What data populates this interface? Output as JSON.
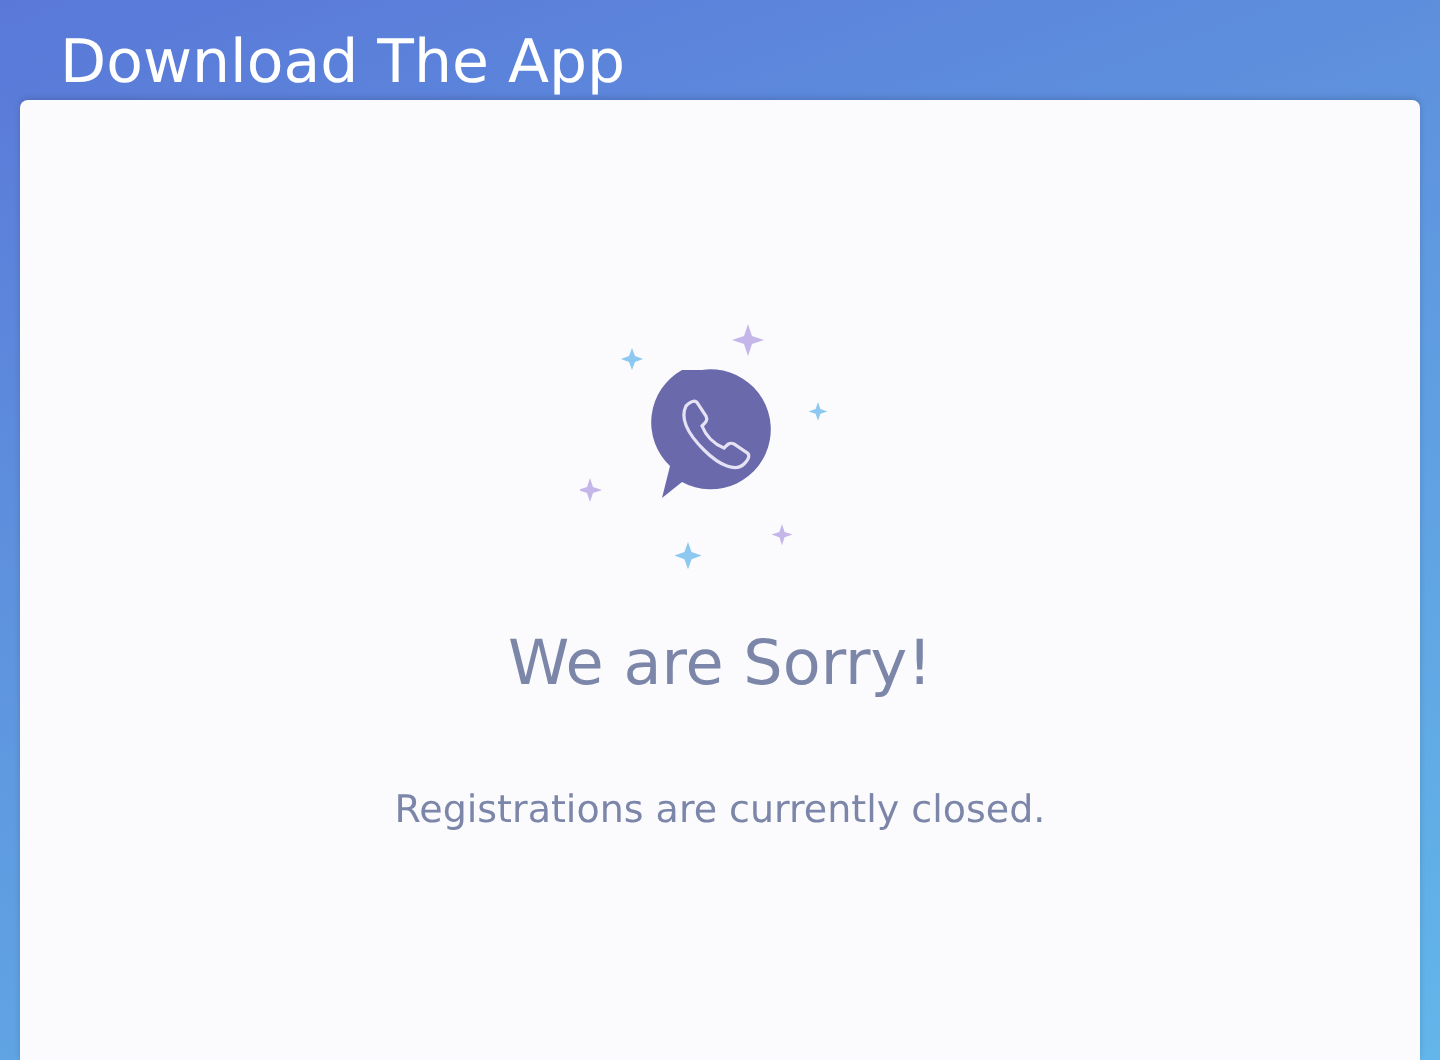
{
  "header": {
    "title": "Download The App"
  },
  "message": {
    "title": "We are Sorry!",
    "text": "Registrations are currently closed."
  }
}
